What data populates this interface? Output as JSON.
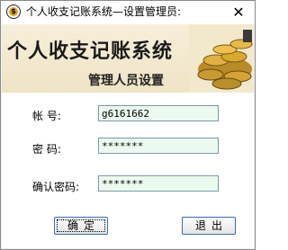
{
  "window": {
    "title": "个人收支记账系统—设置管理员:",
    "close_glyph": "✕",
    "icon_glyph": "$"
  },
  "banner": {
    "title": "个人收支记账系统",
    "subtitle": "管理人员设置"
  },
  "form": {
    "account_label": "帐     号:",
    "account_value": "g6161662",
    "password_label": "密     码:",
    "password_value": "*******",
    "confirm_label": "确认密码:",
    "confirm_value": "*******"
  },
  "buttons": {
    "ok_label": "确定",
    "exit_label": "退出"
  },
  "colors": {
    "input_bg": "#eafaee",
    "banner_bg": "#f2e8cc",
    "button_border": "#3a6ea5"
  }
}
